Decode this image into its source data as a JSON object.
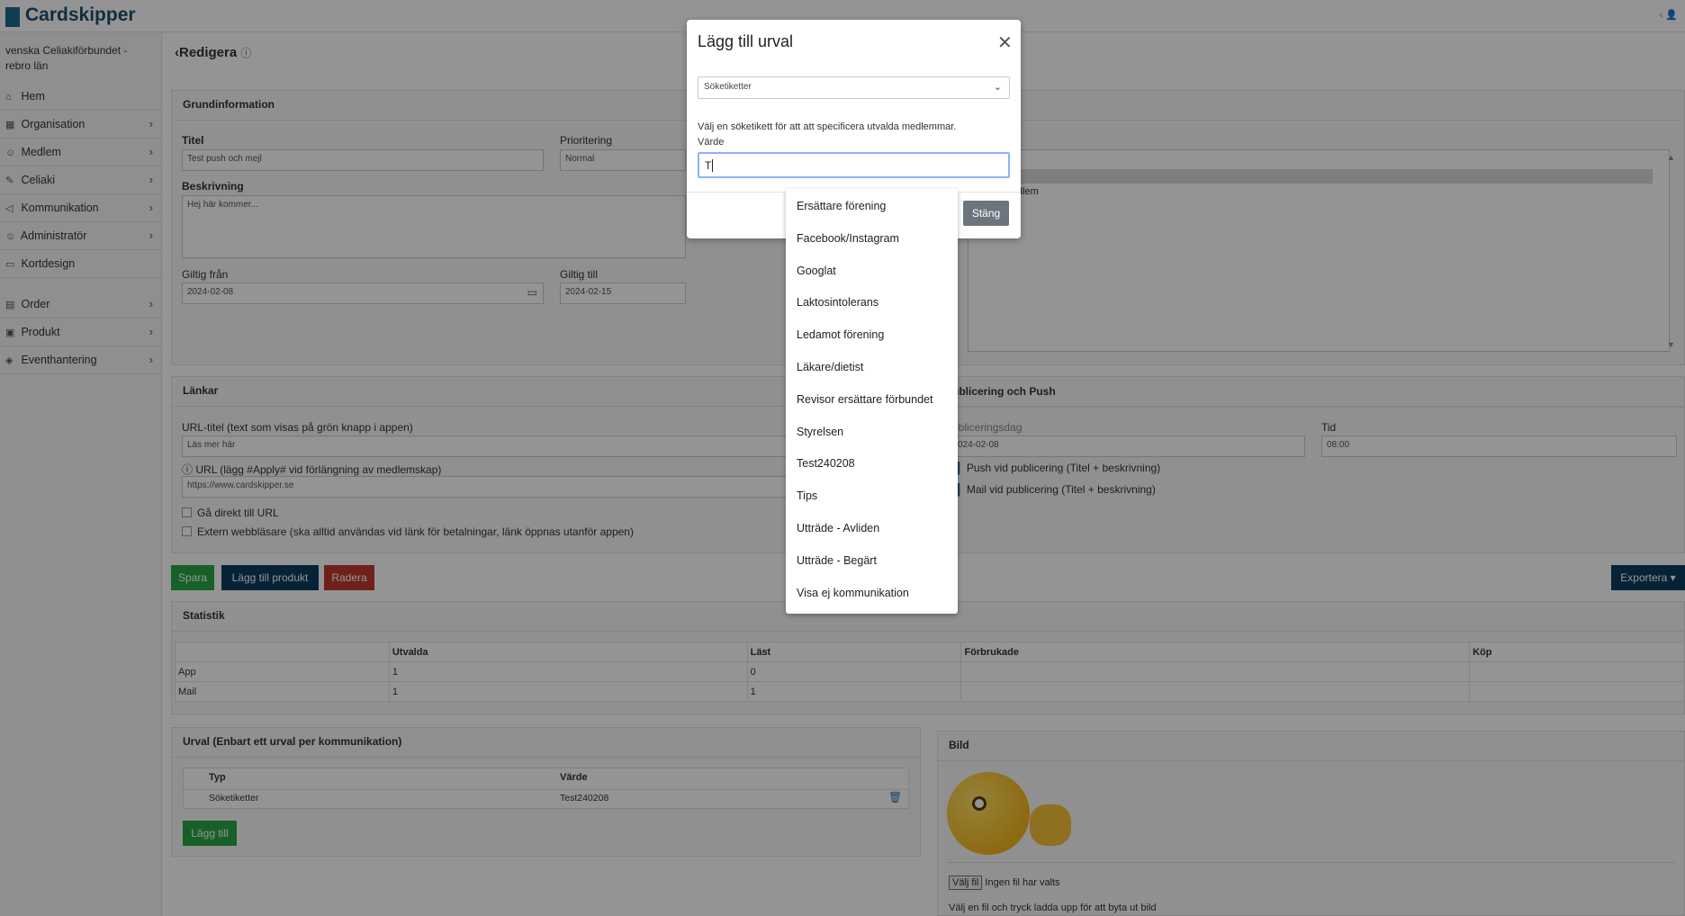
{
  "app": {
    "name": "Cardskipper",
    "top_right": "‹ 👤"
  },
  "sidebar": {
    "org": "venska Celiakiförbundet -\nrebro län",
    "items": [
      {
        "label": "Hem",
        "icon": "home-icon",
        "glyph": "⌂",
        "chevron": false
      },
      {
        "label": "Organisation",
        "icon": "building-icon",
        "glyph": "▦",
        "chevron": true
      },
      {
        "label": "Medlem",
        "icon": "users-icon",
        "glyph": "☺",
        "chevron": true
      },
      {
        "label": "Celiaki",
        "icon": "leaf-icon",
        "glyph": "✎",
        "chevron": true
      },
      {
        "label": "Kommunikation",
        "icon": "megaphone-icon",
        "glyph": "◁",
        "chevron": true
      },
      {
        "label": "Administratör",
        "icon": "user-admin-icon",
        "glyph": "☺",
        "chevron": true
      },
      {
        "label": "Kortdesign",
        "icon": "card-icon",
        "glyph": "▭",
        "chevron": false
      },
      {
        "label": "Order",
        "icon": "cart-icon",
        "glyph": "▤",
        "chevron": true
      },
      {
        "label": "Produkt",
        "icon": "box-icon",
        "glyph": "▣",
        "chevron": true
      },
      {
        "label": "Eventhantering",
        "icon": "event-icon",
        "glyph": "◈",
        "chevron": true
      }
    ]
  },
  "page": {
    "back_title": "Redigera"
  },
  "grund": {
    "header": "Grundinformation",
    "titel_label": "Titel",
    "titel_value": "Test push och mejl",
    "prio_label": "Prioritering",
    "prio_value": "Normal",
    "beskr_label": "Beskrivning",
    "beskr_value": "Hej här kommer...",
    "giltig_fran_label": "Giltig från",
    "giltig_fran_value": "2024-02-08",
    "giltig_till_label": "Giltig till",
    "giltig_till_value": "2024-02-15",
    "right_list_item": "dlem"
  },
  "lankar": {
    "header": "Länkar",
    "url_title_label": "URL-titel (text som visas på grön knapp i appen)",
    "url_title_value": "Läs mer här",
    "url_label": "URL (lägg #Apply# vid förlängning av medlemskap)",
    "url_value": "https://www.cardskipper.se",
    "check1": "Gå direkt till URL",
    "check2": "Extern webbläsare (ska alltid användas vid länk för betalningar, länk öppnas utanför appen)"
  },
  "publicering": {
    "header": "ublicering och Push",
    "dag_label": "ubliceringsdag",
    "dag_value": "024-02-08",
    "tid_label": "Tid",
    "tid_value": "08:00",
    "push_label": "Push vid publicering (Titel + beskrivning)",
    "mail_label": "Mail vid publicering (Titel + beskrivning)"
  },
  "buttons": {
    "spara": "Spara",
    "lagg_till_produkt": "Lägg till produkt",
    "radera": "Radera",
    "exportera": "Exportera ▾"
  },
  "statistik": {
    "header": "Statistik",
    "columns": [
      "",
      "Utvalda",
      "Läst",
      "Förbrukade",
      "Köp"
    ],
    "rows": [
      [
        "App",
        "1",
        "0",
        "",
        ""
      ],
      [
        "Mail",
        "1",
        "1",
        "",
        ""
      ]
    ]
  },
  "urval": {
    "header": "Urval (Enbart ett urval per kommunikation)",
    "col_typ": "Typ",
    "col_varde": "Värde",
    "row_typ": "Söketiketter",
    "row_varde": "Test240208",
    "lagg_till": "Lägg till"
  },
  "bild": {
    "header": "Bild",
    "file_button": "Välj fil",
    "file_status": "Ingen fil har valts",
    "help": "Välj en fil och tryck ladda upp för att byta ut bild"
  },
  "modal": {
    "title": "Lägg till urval",
    "select_value": "Söketiketter",
    "help": "Välj en söketikett för att att specificera utvalda medlemmar.",
    "varde_label": "Värde",
    "input_value": "T",
    "stang": "Stäng"
  },
  "dropdown": {
    "items": [
      "Ersättare förening",
      "Facebook/Instagram",
      "Googlat",
      "Laktosintolerans",
      "Ledamot förening",
      "Läkare/dietist",
      "Revisor ersättare förbundet",
      "Styrelsen",
      "Test240208",
      "Tips",
      "Utträde - Avliden",
      "Utträde - Begärt",
      "Visa ej kommunikation"
    ]
  },
  "colors": {
    "green": "#28a745",
    "navy": "#0b3c5d",
    "red": "#c0392b",
    "grey": "#6c757d"
  }
}
